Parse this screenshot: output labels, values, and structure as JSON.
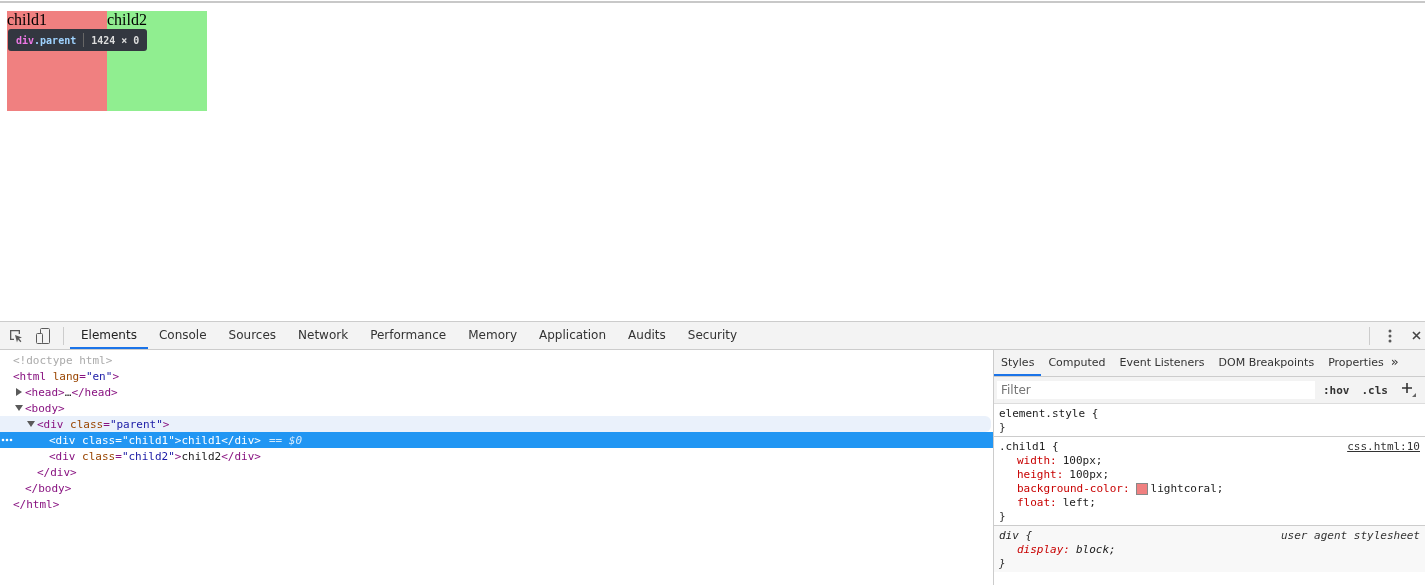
{
  "page": {
    "boxes": [
      {
        "label": "child1",
        "color": "#f08080"
      },
      {
        "label": "child2",
        "color": "#90ee90"
      }
    ],
    "tooltip": {
      "tag": "div",
      "class_name": ".parent",
      "size": "1424 × 0"
    }
  },
  "devtools": {
    "tabs": [
      {
        "label": "Elements",
        "selected": true
      },
      {
        "label": "Console",
        "selected": false
      },
      {
        "label": "Sources",
        "selected": false
      },
      {
        "label": "Network",
        "selected": false
      },
      {
        "label": "Performance",
        "selected": false
      },
      {
        "label": "Memory",
        "selected": false
      },
      {
        "label": "Application",
        "selected": false
      },
      {
        "label": "Audits",
        "selected": false
      },
      {
        "label": "Security",
        "selected": false
      }
    ],
    "dom_tree": [
      {
        "open": [
          {
            "kind": "comment",
            "text": "<!doctype html>"
          }
        ]
      },
      {
        "open": [
          {
            "kind": "tag",
            "text": "<html"
          },
          {
            "kind": "attr",
            "text": " lang"
          },
          {
            "kind": "tag",
            "text": "="
          },
          {
            "kind": "value",
            "text": "\"en\""
          },
          {
            "kind": "tag",
            "text": ">"
          }
        ],
        "close": [
          {
            "kind": "tag",
            "text": "</html>"
          }
        ],
        "children": [
          {
            "expanded": false,
            "open": [
              {
                "kind": "tag",
                "text": "<head>"
              },
              {
                "kind": "text",
                "text": "…"
              },
              {
                "kind": "tag",
                "text": "</head>"
              }
            ]
          },
          {
            "expanded": true,
            "open": [
              {
                "kind": "tag",
                "text": "<body>"
              }
            ],
            "close": [
              {
                "kind": "tag",
                "text": "</body>"
              }
            ],
            "children": [
              {
                "expanded": true,
                "hovered": true,
                "open": [
                  {
                    "kind": "tag",
                    "text": "<div"
                  },
                  {
                    "kind": "attr",
                    "text": " class"
                  },
                  {
                    "kind": "tag",
                    "text": "="
                  },
                  {
                    "kind": "value",
                    "text": "\"parent\""
                  },
                  {
                    "kind": "tag",
                    "text": ">"
                  }
                ],
                "close": [
                  {
                    "kind": "tag",
                    "text": "</div>"
                  }
                ],
                "children": [
                  {
                    "selected": true,
                    "suffix": "== $0",
                    "open": [
                      {
                        "kind": "tag",
                        "text": "<div"
                      },
                      {
                        "kind": "attr",
                        "text": " class"
                      },
                      {
                        "kind": "tag",
                        "text": "="
                      },
                      {
                        "kind": "value",
                        "text": "\"child1\""
                      },
                      {
                        "kind": "tag",
                        "text": ">"
                      },
                      {
                        "kind": "text",
                        "text": "child1"
                      },
                      {
                        "kind": "tag",
                        "text": "</div>"
                      }
                    ]
                  },
                  {
                    "selected": false,
                    "open": [
                      {
                        "kind": "tag",
                        "text": "<div"
                      },
                      {
                        "kind": "attr",
                        "text": " class"
                      },
                      {
                        "kind": "tag",
                        "text": "="
                      },
                      {
                        "kind": "value",
                        "text": "\"child2\""
                      },
                      {
                        "kind": "tag",
                        "text": ">"
                      },
                      {
                        "kind": "text",
                        "text": "child2"
                      },
                      {
                        "kind": "tag",
                        "text": "</div>"
                      }
                    ]
                  }
                ]
              }
            ]
          }
        ]
      }
    ],
    "sidebar": {
      "tabs": [
        {
          "label": "Styles",
          "selected": true
        },
        {
          "label": "Computed",
          "selected": false
        },
        {
          "label": "Event Listeners",
          "selected": false
        },
        {
          "label": "DOM Breakpoints",
          "selected": false
        },
        {
          "label": "Properties",
          "selected": false
        }
      ],
      "overflow": "»",
      "filter": {
        "placeholder": "Filter"
      },
      "hov": ":hov",
      "cls": ".cls",
      "rules": [
        {
          "kind": "inline",
          "header": "element.style {",
          "close": "}"
        },
        {
          "kind": "author",
          "header": ".child1 {",
          "source": "css.html:10",
          "close": "}",
          "properties": [
            {
              "name": "width:",
              "value": "100px;"
            },
            {
              "name": "height:",
              "value": "100px;"
            },
            {
              "name": "background-color:",
              "color": "#f08080",
              "value": "lightcoral;"
            },
            {
              "name": "float:",
              "value": "left;"
            }
          ]
        },
        {
          "kind": "user-agent",
          "header": "div {",
          "source": "user agent stylesheet",
          "close": "}",
          "properties": [
            {
              "name": "display:",
              "value": "block;"
            }
          ]
        }
      ]
    }
  }
}
